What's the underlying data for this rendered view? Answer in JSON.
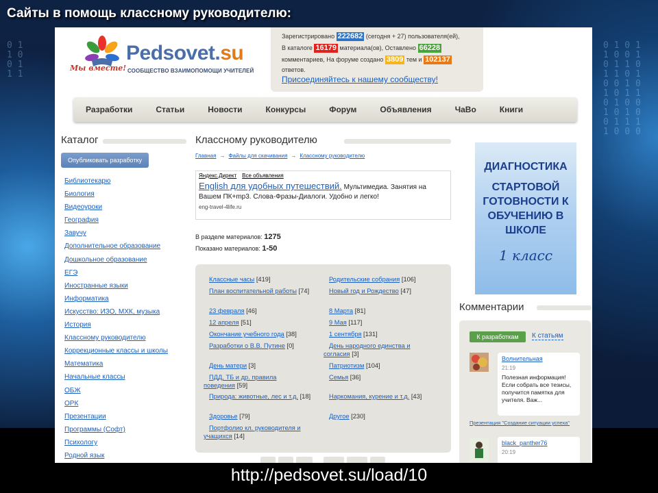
{
  "slide": {
    "title": "Сайты в помощь классному руководителю:",
    "url": "http://pedsovet.su/load/10"
  },
  "header": {
    "logo_text": "Pedsovet.",
    "logo_text_accent": "su",
    "logo_subtitle": "СООБЩЕСТВО ВЗАИМОПОМОЩИ УЧИТЕЛЕЙ",
    "logo_slogan": "Мы вместе!"
  },
  "stats": {
    "t1": "Зарегистрировано",
    "users": "222682",
    "t2": "(сегодня + 27) пользователя(ей),",
    "t3": "В каталоге",
    "materials": "16179",
    "t4": "материала(ов), Оставлено",
    "comments": "66228",
    "t5": "комментариев, На форуме создано",
    "topics": "3809",
    "t6": "тем и",
    "answers": "102137",
    "t7": "ответов.",
    "join_link": "Присоединяйтесь к нашему сообществу!"
  },
  "nav": [
    "Разработки",
    "Статьи",
    "Новости",
    "Конкурсы",
    "Форум",
    "Объявления",
    "ЧаВо",
    "Книги"
  ],
  "catalog": {
    "title": "Каталог",
    "publish_button": "Опубликовать разработку",
    "items": [
      "Библиотекарю",
      "Биология",
      "Видеоуроки",
      "География",
      "Завучу",
      "Дополнительное образование",
      "Дошкольное образование",
      "ЕГЭ",
      "Иностранные языки",
      "Информатика",
      "Искусство: ИЗО, МХК, музыка",
      "История",
      "Классному руководителю",
      "Коррекционные классы и школы",
      "Математика",
      "Начальные классы",
      "ОБЖ",
      "ОРК",
      "Презентации",
      "Программы (Софт)",
      "Психологу",
      "Родной язык"
    ]
  },
  "main": {
    "title": "Классному руководителю",
    "breadcrumbs": [
      "Главная",
      "Файлы для скачивания",
      "Классному руководителю"
    ],
    "ad": {
      "label": "Яндекс.Директ",
      "all": "Все объявления",
      "link": "English для удобных путешествий.",
      "text": "Мультимедиа. Занятия на Вашем ПК+mp3. Слова-Фразы-Диалоги. Удобно и легко!",
      "domain": "eng-travel-4life.ru"
    },
    "in_section_label": "В разделе материалов:",
    "in_section_value": "1275",
    "shown_label": "Показано материалов:",
    "shown_value": "1-50",
    "folders_left": [
      {
        "name": "Классные часы",
        "count": "[419]"
      },
      {
        "name": "План воспитательной работы",
        "count": "[74]"
      },
      {
        "name": "23 февраля",
        "count": "[46]"
      },
      {
        "name": "12 апреля",
        "count": "[51]"
      },
      {
        "name": "Окончание учебного года",
        "count": "[38]"
      },
      {
        "name": "Разработки о В.В. Путине",
        "count": "[0]"
      },
      {
        "name": "День матери",
        "count": "[3]"
      },
      {
        "name": "ПДД, ТБ и др. правила поведения",
        "count": "[59]"
      },
      {
        "name": "Природа: животные, лес и т.д.",
        "count": "[18]"
      },
      {
        "name": "Здоровье",
        "count": "[79]"
      },
      {
        "name": "Портфолио кл. руководителя и учащихся",
        "count": "[14]"
      }
    ],
    "folders_right": [
      {
        "name": "Родительские собрания",
        "count": "[106]"
      },
      {
        "name": "Новый год и Рождество",
        "count": "[47]"
      },
      {
        "name": "8 Марта",
        "count": "[81]"
      },
      {
        "name": "9 Мая",
        "count": "[117]"
      },
      {
        "name": "1 сентября",
        "count": "[131]"
      },
      {
        "name": "День народного единства и согласия",
        "count": "[3]"
      },
      {
        "name": "Патриотизм",
        "count": "[104]"
      },
      {
        "name": "Семья",
        "count": "[36]"
      },
      {
        "name": "Наркомания, курение и т.д.",
        "count": "[43]"
      },
      {
        "name": "Другое",
        "count": "[230]"
      }
    ]
  },
  "banner": {
    "line1": "ДИАГНОСТИКА",
    "line2": "СТАРТОВОЙ ГОТОВНОСТИ К ОБУЧЕНИЮ В ШКОЛЕ",
    "line3": "1 класс"
  },
  "comments": {
    "title": "Комментарии",
    "tab_active": "К разработкам",
    "tab_other": "К статьям",
    "items": [
      {
        "user": "Волнительная",
        "time": "21:19",
        "text": "Полезная информация! Если собрать все тезисы, получится памятка для учителя. Важ...",
        "ref": "Презентация \"Создание ситуации успеха\""
      },
      {
        "user": "black_panther76",
        "time": "20:19"
      }
    ]
  }
}
